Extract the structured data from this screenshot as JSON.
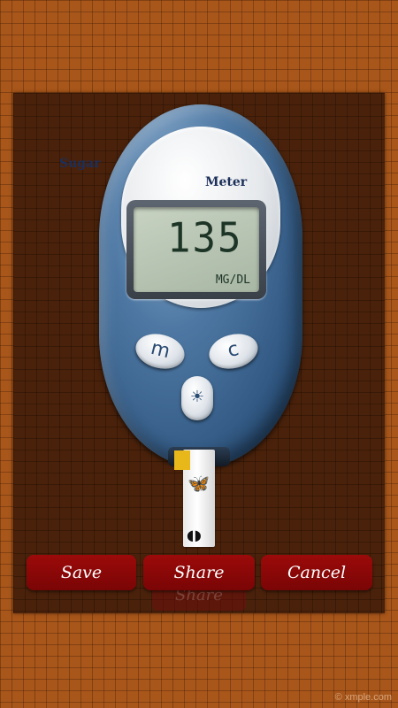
{
  "device": {
    "brand_line1": "Sugar",
    "brand_line2": "Meter",
    "reading_value": "135",
    "reading_unit": "MG/DL",
    "button_m_label": "m",
    "button_c_label": "c",
    "button_light_icon": "light-icon"
  },
  "actions": {
    "save_label": "Save",
    "share_label": "Share",
    "cancel_label": "Cancel",
    "ghost_share_label": "Share"
  },
  "footer": {
    "watermark": "© xmple.com"
  },
  "colors": {
    "background": "#a8561a",
    "panel": "#4a220b",
    "button_red": "#8a0808",
    "meter_blue": "#4e78a3",
    "lcd_green": "#1d3527"
  }
}
